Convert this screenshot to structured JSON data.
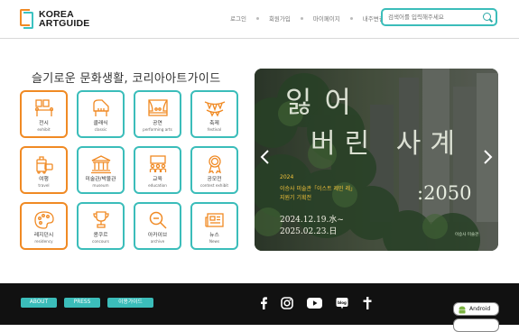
{
  "header": {
    "logo_line1": "KOREA",
    "logo_line2": "ARTGUIDE",
    "nav": [
      "로그인",
      "회원가입",
      "마이페이지",
      "내주변검색"
    ],
    "search_placeholder": "검색어를 입력해주세요"
  },
  "main": {
    "tagline": "슬기로운 문화생활, 코리아아트가이드",
    "categories": [
      {
        "ko": "전시",
        "en": "exhibit",
        "icon": "exhibit-icon",
        "accent": "orange"
      },
      {
        "ko": "클래식",
        "en": "classic",
        "icon": "piano-icon",
        "accent": "teal"
      },
      {
        "ko": "공연",
        "en": "performing arts",
        "icon": "stage-icon",
        "accent": "teal"
      },
      {
        "ko": "축제",
        "en": "festival",
        "icon": "bunting-icon",
        "accent": "teal"
      },
      {
        "ko": "여행",
        "en": "travel",
        "icon": "luggage-icon",
        "accent": "orange"
      },
      {
        "ko": "미술관/박물관",
        "en": "museum",
        "icon": "museum-icon",
        "accent": "teal"
      },
      {
        "ko": "교육",
        "en": "education",
        "icon": "education-icon",
        "accent": "teal"
      },
      {
        "ko": "공모전",
        "en": "contest exhibit",
        "icon": "medal-icon",
        "accent": "teal"
      },
      {
        "ko": "레지던시",
        "en": "residency",
        "icon": "palette-icon",
        "accent": "orange"
      },
      {
        "ko": "콩쿠르",
        "en": "concours",
        "icon": "trophy-icon",
        "accent": "teal"
      },
      {
        "ko": "아카이브",
        "en": "archive",
        "icon": "magnifier-icon",
        "accent": "teal"
      },
      {
        "ko": "뉴스",
        "en": "News",
        "icon": "newspaper-icon",
        "accent": "teal"
      }
    ]
  },
  "banner": {
    "title_line1": "잃어",
    "title_line2": "버린 사계",
    "number": ":2050",
    "year": "2024",
    "desc_line1": "이승사 미술관「이스트 제민 레」",
    "desc_line2": "지원기 기획전",
    "date_start": "2024.12.19.水~",
    "date_end": "2025.02.23.日",
    "organizer": "이승사 미술관"
  },
  "footer": {
    "buttons": [
      "ABOUT",
      "PRESS",
      "이용가이드"
    ],
    "social": [
      "facebook-icon",
      "instagram-icon",
      "youtube-icon",
      "blog-icon",
      "cross-icon"
    ],
    "store_android": "Android"
  },
  "colors": {
    "teal": "#3bbdba",
    "orange": "#f08a24",
    "footer_bg": "#111111"
  }
}
